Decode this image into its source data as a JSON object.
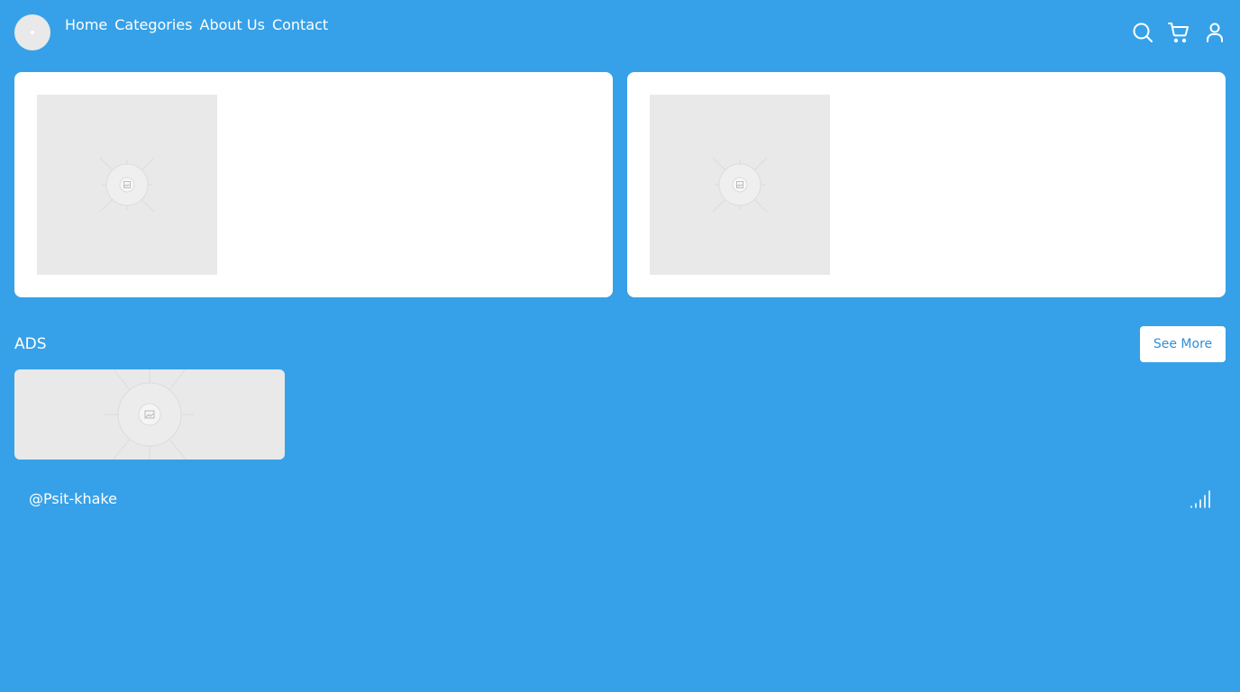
{
  "header": {
    "nav": [
      "Home",
      "Categories",
      "About Us",
      "Contact"
    ],
    "icons": [
      "search-icon",
      "cart-icon",
      "user-icon"
    ]
  },
  "cards": [
    {
      "image": "image-placeholder"
    },
    {
      "image": "image-placeholder"
    }
  ],
  "ads": {
    "title": "ADS",
    "see_more_label": "See More",
    "banner_image": "image-placeholder"
  },
  "footer": {
    "handle": "@Psit-khake",
    "icon": "signal-bars-icon"
  },
  "colors": {
    "background": "#36a1e8",
    "card": "#ffffff",
    "placeholder": "#e9e9e9",
    "button_text": "#2f8fd8"
  }
}
